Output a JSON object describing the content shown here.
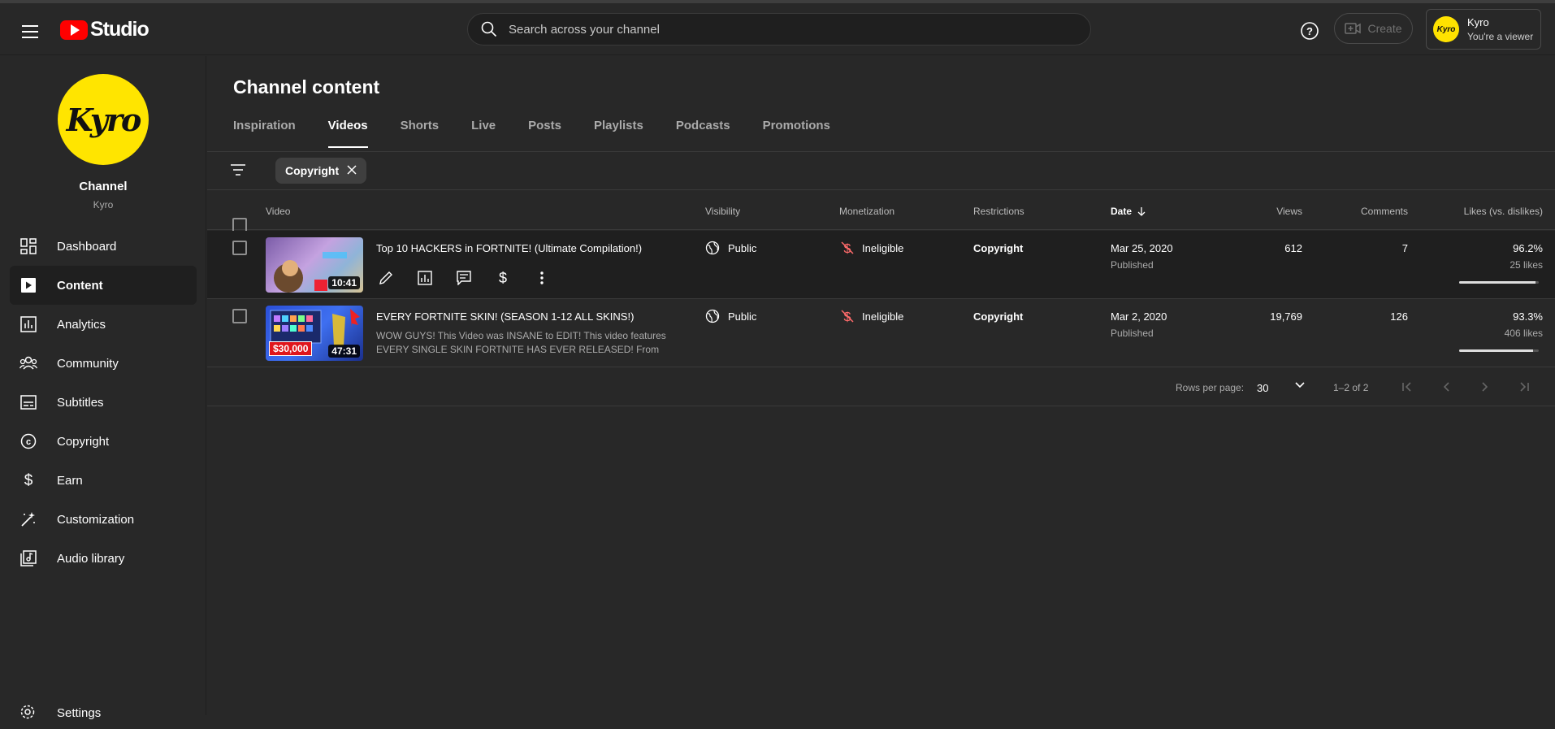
{
  "header": {
    "app_name": "Studio",
    "search_placeholder": "Search across your channel",
    "create_label": "Create",
    "account_name": "Kyro",
    "account_role": "You're a viewer",
    "account_avatar_text": "Kyro"
  },
  "sidebar": {
    "channel_avatar_text": "Kyro",
    "channel_label": "Channel",
    "channel_name": "Kyro",
    "items": [
      {
        "label": "Dashboard",
        "icon": "dashboard-icon"
      },
      {
        "label": "Content",
        "icon": "content-icon",
        "active": true
      },
      {
        "label": "Analytics",
        "icon": "analytics-icon"
      },
      {
        "label": "Community",
        "icon": "community-icon"
      },
      {
        "label": "Subtitles",
        "icon": "subtitles-icon"
      },
      {
        "label": "Copyright",
        "icon": "copyright-icon"
      },
      {
        "label": "Earn",
        "icon": "earn-icon"
      },
      {
        "label": "Customization",
        "icon": "customization-icon"
      },
      {
        "label": "Audio library",
        "icon": "audio-library-icon"
      }
    ],
    "settings_label": "Settings"
  },
  "main": {
    "title": "Channel content",
    "tabs": [
      "Inspiration",
      "Videos",
      "Shorts",
      "Live",
      "Posts",
      "Playlists",
      "Podcasts",
      "Promotions"
    ],
    "active_tab": "Videos",
    "filter_chip": "Copyright",
    "columns": {
      "video": "Video",
      "visibility": "Visibility",
      "monetization": "Monetization",
      "restrictions": "Restrictions",
      "date": "Date",
      "views": "Views",
      "comments": "Comments",
      "likes": "Likes (vs. dislikes)"
    },
    "rows": [
      {
        "title": "Top 10 HACKERS in FORTNITE! (Ultimate Compilation!)",
        "duration": "10:41",
        "visibility": "Public",
        "monetization": "Ineligible",
        "restrictions": "Copyright",
        "date": "Mar 25, 2020",
        "status": "Published",
        "views": "612",
        "comments": "7",
        "likes_pct": "96.2%",
        "likes_count": "25 likes",
        "likes_ratio": 0.962
      },
      {
        "title": "EVERY FORTNITE SKIN! (SEASON 1-12 ALL SKINS!)",
        "description": "WOW GUYS! This Video was INSANE to EDIT! This video features EVERY SINGLE SKIN FORTNITE HAS EVER RELEASED! From the…",
        "duration": "47:31",
        "thumb_badge": "$30,000",
        "visibility": "Public",
        "monetization": "Ineligible",
        "restrictions": "Copyright",
        "date": "Mar 2, 2020",
        "status": "Published",
        "views": "19,769",
        "comments": "126",
        "likes_pct": "93.3%",
        "likes_count": "406 likes",
        "likes_ratio": 0.933
      }
    ],
    "pager": {
      "rows_per_page_label": "Rows per page:",
      "rows_per_page": "30",
      "range": "1–2 of 2"
    }
  },
  "colors": {
    "background": "#282828",
    "accent_red": "#ff0000",
    "brand_yellow": "#ffe500",
    "ineligible": "#ff6b6b"
  }
}
